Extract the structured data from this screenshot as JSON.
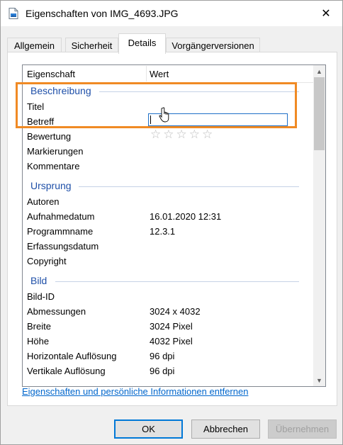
{
  "window": {
    "title": "Eigenschaften von IMG_4693.JPG",
    "close_glyph": "✕"
  },
  "tabs": [
    {
      "label": "Allgemein"
    },
    {
      "label": "Sicherheit"
    },
    {
      "label": "Details"
    },
    {
      "label": "Vorgängerversionen"
    }
  ],
  "list": {
    "col_property": "Eigenschaft",
    "col_value": "Wert",
    "groups": {
      "beschreibung": "Beschreibung",
      "ursprung": "Ursprung",
      "bild": "Bild"
    },
    "rows": {
      "titel": {
        "label": "Titel",
        "value": ""
      },
      "betreff": {
        "label": "Betreff"
      },
      "bewertung": {
        "label": "Bewertung",
        "stars": "☆☆☆☆☆",
        "rating": 0
      },
      "markierungen": {
        "label": "Markierungen"
      },
      "kommentare": {
        "label": "Kommentare"
      },
      "autoren": {
        "label": "Autoren"
      },
      "aufnahmedatum": {
        "label": "Aufnahmedatum",
        "value": "16.01.2020 12:31"
      },
      "programmname": {
        "label": "Programmname",
        "value": "12.3.1"
      },
      "erfassungsdatum": {
        "label": "Erfassungsdatum"
      },
      "copyright": {
        "label": "Copyright"
      },
      "bild_id": {
        "label": "Bild-ID"
      },
      "abmessungen": {
        "label": "Abmessungen",
        "value": "3024 x 4032"
      },
      "breite": {
        "label": "Breite",
        "value": "3024 Pixel"
      },
      "hoehe": {
        "label": "Höhe",
        "value": "4032 Pixel"
      },
      "hor_aufl": {
        "label": "Horizontale Auflösung",
        "value": "96 dpi"
      },
      "vert_aufl": {
        "label": "Vertikale Auflösung",
        "value": "96 dpi"
      }
    }
  },
  "link_text": "Eigenschaften und persönliche Informationen entfernen",
  "buttons": {
    "ok": "OK",
    "cancel": "Abbrechen",
    "apply": "Übernehmen"
  },
  "colors": {
    "highlight": "#f08a24",
    "group_heading": "#1e4fa8",
    "link": "#0066cc"
  }
}
